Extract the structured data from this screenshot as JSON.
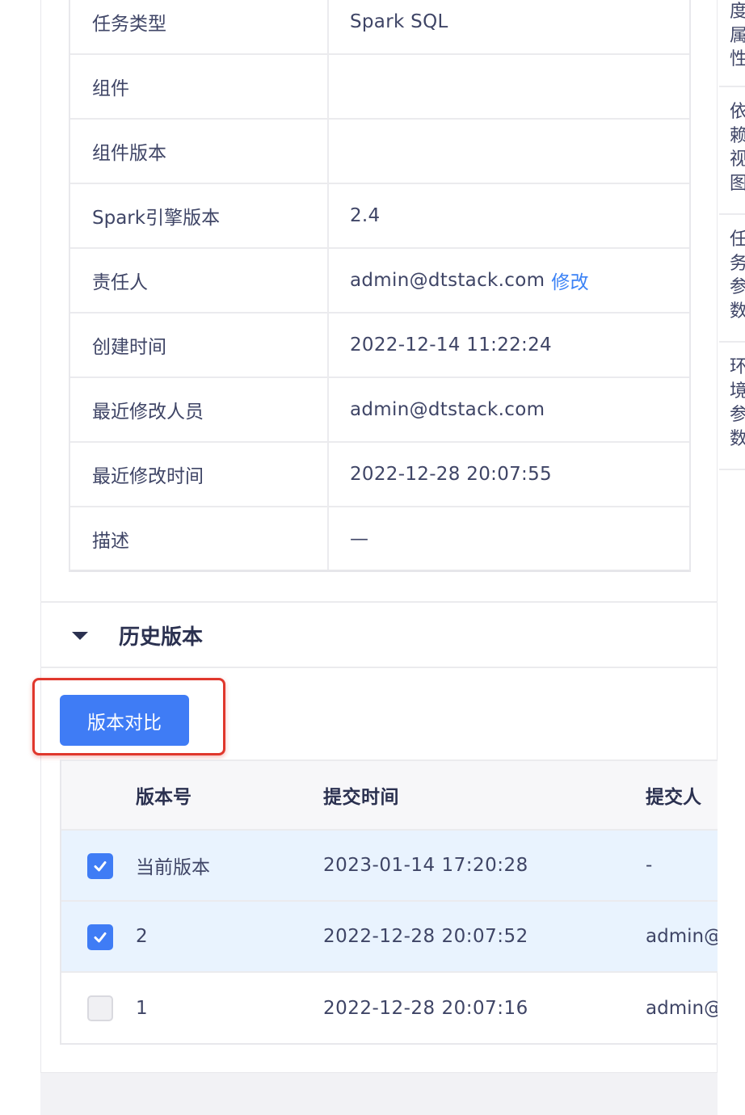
{
  "info_table": {
    "rows": [
      {
        "label": "任务类型",
        "value": "Spark SQL"
      },
      {
        "label": "组件",
        "value": ""
      },
      {
        "label": "组件版本",
        "value": ""
      },
      {
        "label": "Spark引擎版本",
        "value": "2.4"
      },
      {
        "label": "责任人",
        "value": "admin@dtstack.com",
        "link": "修改"
      },
      {
        "label": "创建时间",
        "value": "2022-12-14 11:22:24"
      },
      {
        "label": "最近修改人员",
        "value": "admin@dtstack.com"
      },
      {
        "label": "最近修改时间",
        "value": "2022-12-28 20:07:55"
      },
      {
        "label": "描述",
        "value": "—"
      }
    ]
  },
  "history": {
    "title": "历史版本",
    "compare_button": "版本对比",
    "columns": {
      "version": "版本号",
      "time": "提交时间",
      "user": "提交人"
    },
    "rows": [
      {
        "version": "当前版本",
        "time": "2023-01-14 17:20:28",
        "user": "-",
        "checked": true
      },
      {
        "version": "2",
        "time": "2022-12-28 20:07:52",
        "user": "admin@",
        "checked": true
      },
      {
        "version": "1",
        "time": "2022-12-28 20:07:16",
        "user": "admin@",
        "checked": false
      }
    ]
  },
  "sidebar": {
    "tabs": [
      {
        "chars": [
          "度",
          "属",
          "性"
        ]
      },
      {
        "chars": [
          "依",
          "赖",
          "视",
          "图"
        ]
      },
      {
        "chars": [
          "任",
          "务",
          "参",
          "数"
        ]
      },
      {
        "chars": [
          "环",
          "境",
          "参",
          "数"
        ]
      }
    ]
  },
  "colors": {
    "primary": "#3f7cf5",
    "link": "#3b82f6",
    "highlight": "#e0372c",
    "selected_row": "#e9f3fe"
  }
}
